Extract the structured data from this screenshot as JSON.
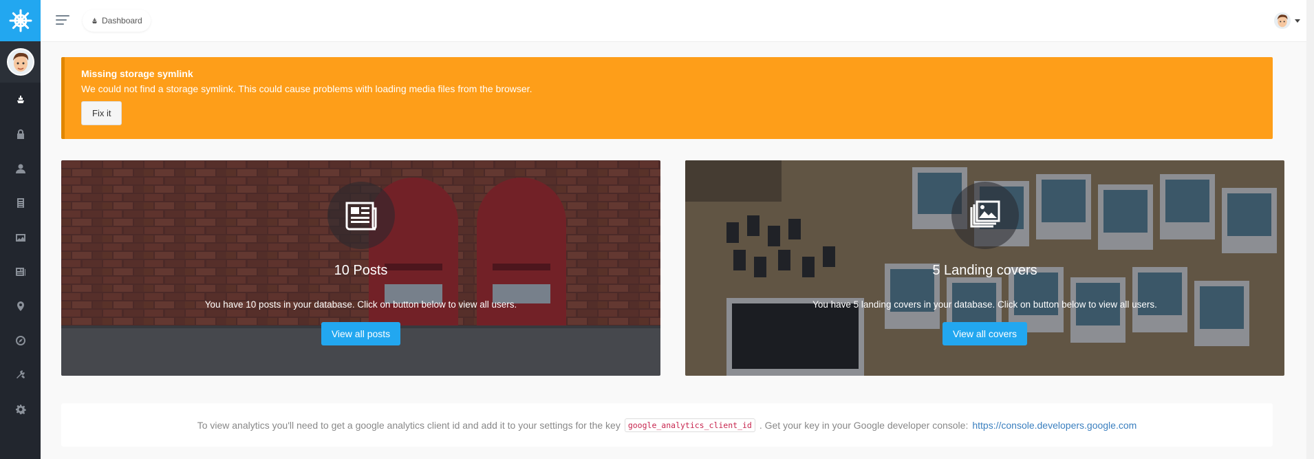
{
  "breadcrumb": {
    "label": "Dashboard",
    "icon": "boat-icon"
  },
  "sidebar": {
    "items": [
      {
        "name": "dashboard",
        "icon": "boat-icon",
        "active": true
      },
      {
        "name": "lock",
        "icon": "lock-icon"
      },
      {
        "name": "users",
        "icon": "person-icon"
      },
      {
        "name": "posts",
        "icon": "document-icon"
      },
      {
        "name": "media",
        "icon": "photo-icon"
      },
      {
        "name": "pages",
        "icon": "news-icon"
      },
      {
        "name": "locations",
        "icon": "location-icon"
      },
      {
        "name": "compass",
        "icon": "compass-icon"
      },
      {
        "name": "tools",
        "icon": "tools-icon"
      },
      {
        "name": "settings",
        "icon": "gear-icon"
      }
    ]
  },
  "alert": {
    "title": "Missing storage symlink",
    "text": "We could not find a storage symlink. This could cause problems with loading media files from the browser.",
    "button": "Fix it",
    "color": "#fe9e19"
  },
  "posts_panel": {
    "count": "10 Posts",
    "description": "You have 10 posts in your database. Click on button below to view all users.",
    "button": "View all posts"
  },
  "covers_panel": {
    "count": "5 Landing covers",
    "description": "You have 5 landing covers in your database. Click on button below to view all users.",
    "button": "View all covers"
  },
  "analytics": {
    "text_before": "To view analytics you'll need to get a google analytics client id and add it to your settings for the key",
    "key": "google_analytics_client_id",
    "text_after": ". Get your key in your Google developer console:",
    "link": "https://console.developers.google.com"
  },
  "colors": {
    "accent": "#22a7f0",
    "sidebar": "#22262e",
    "warning": "#fe9e19"
  }
}
